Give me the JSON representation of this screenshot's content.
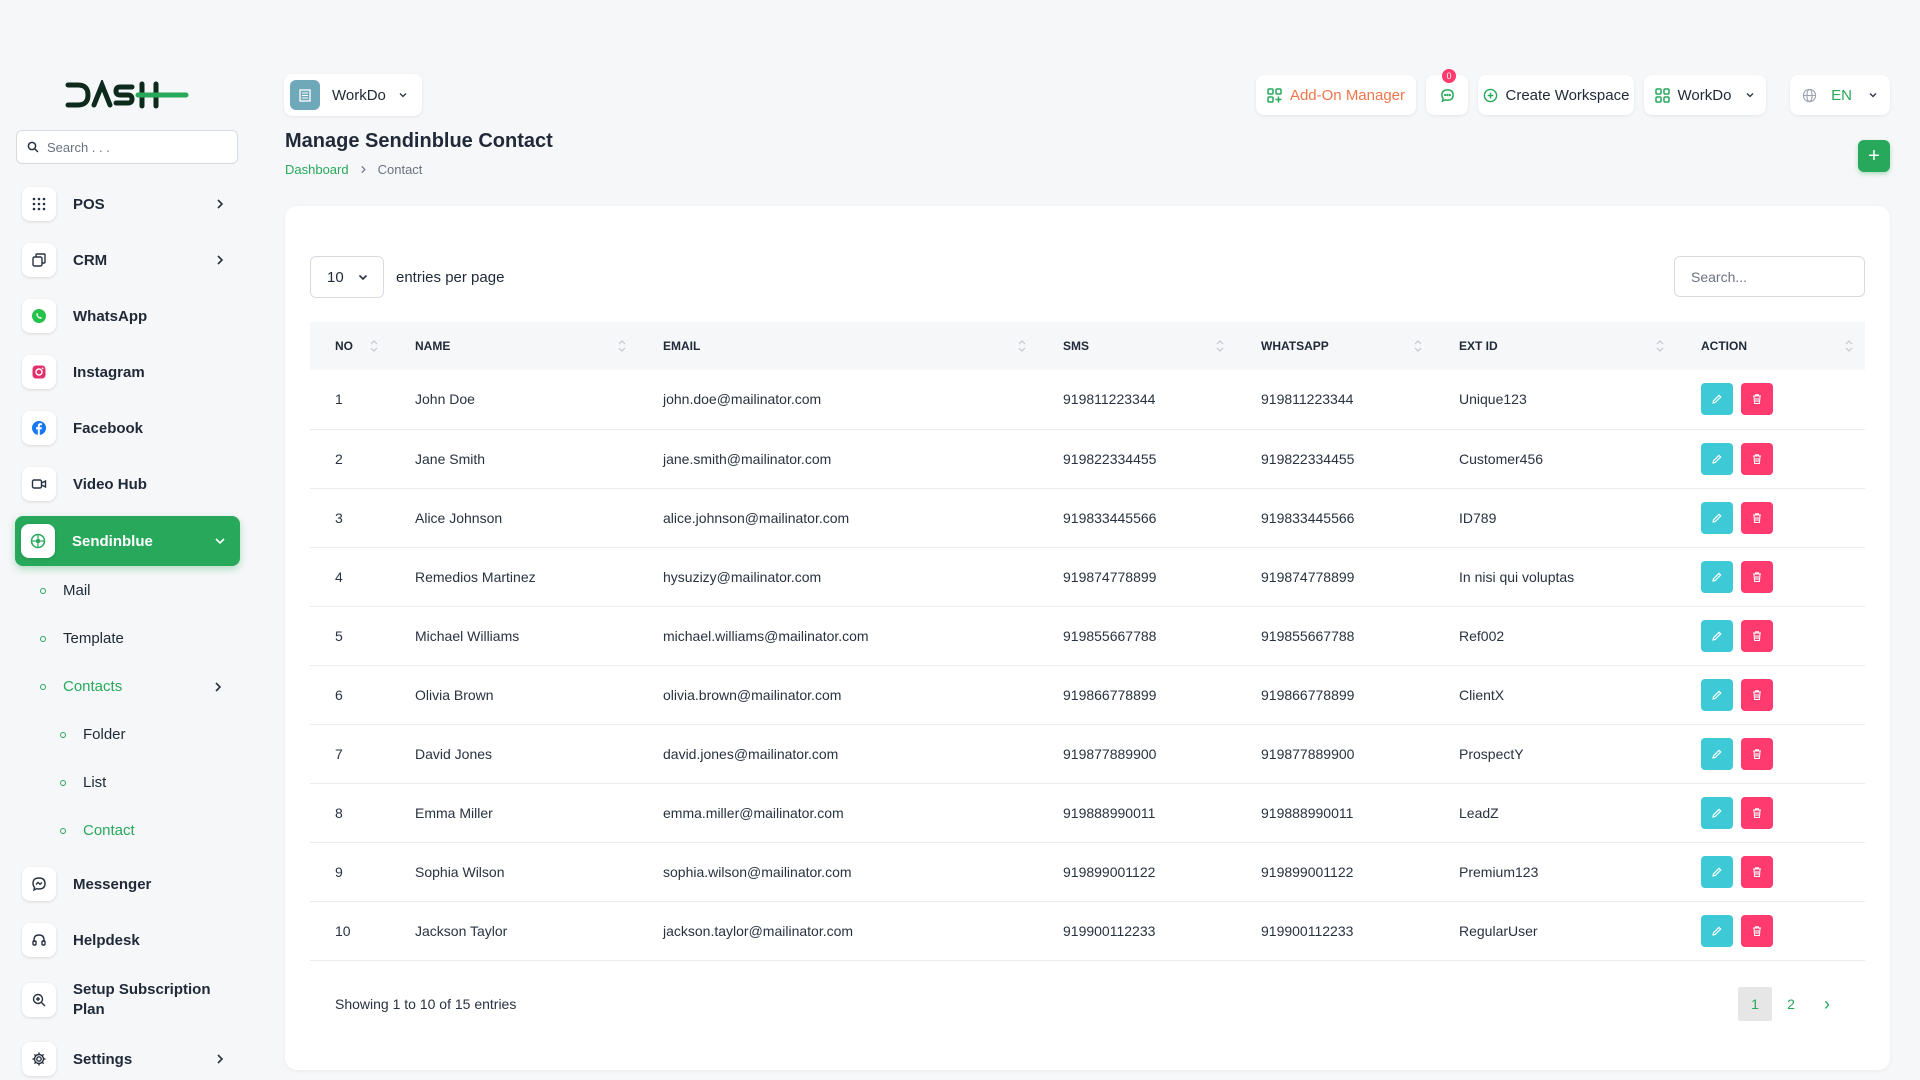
{
  "brand": {
    "logo_text": "DASH",
    "accent": "#27a85a"
  },
  "sidebar": {
    "search_placeholder": "Search . . .",
    "items": [
      {
        "label": "POS",
        "icon": "grid-icon",
        "has_children": true
      },
      {
        "label": "CRM",
        "icon": "layers-icon",
        "has_children": true
      },
      {
        "label": "WhatsApp",
        "icon": "whatsapp-icon",
        "has_children": false
      },
      {
        "label": "Instagram",
        "icon": "instagram-icon",
        "has_children": false
      },
      {
        "label": "Facebook",
        "icon": "facebook-icon",
        "has_children": false
      },
      {
        "label": "Video Hub",
        "icon": "video-icon",
        "has_children": false
      },
      {
        "label": "Sendinblue",
        "icon": "sendinblue-icon",
        "has_children": true,
        "active": true
      }
    ],
    "sendinblue_sub": {
      "mail": "Mail",
      "template": "Template",
      "contacts": "Contacts",
      "contacts_sub": {
        "folder": "Folder",
        "list": "List",
        "contact": "Contact"
      }
    },
    "lower_items": [
      {
        "label": "Messenger",
        "icon": "messenger-icon"
      },
      {
        "label": "Helpdesk",
        "icon": "headset-icon"
      },
      {
        "label": "Setup Subscription Plan",
        "label_line1": "Setup Subscription",
        "label_line2": "Plan",
        "icon": "search-plan-icon"
      },
      {
        "label": "Settings",
        "icon": "gear-icon",
        "has_children": true
      }
    ]
  },
  "topbar": {
    "workspace_name": "WorkDo",
    "addon_manager": "Add-On Manager",
    "messages_badge": "0",
    "create_workspace": "Create Workspace",
    "workspace_menu": "WorkDo",
    "language": "EN"
  },
  "page": {
    "title": "Manage Sendinblue Contact",
    "breadcrumb": {
      "home": "Dashboard",
      "current": "Contact"
    },
    "add_label": "+"
  },
  "table_controls": {
    "entries_value": "10",
    "entries_label": "entries per page",
    "search_placeholder": "Search..."
  },
  "table": {
    "columns": [
      "NO",
      "NAME",
      "EMAIL",
      "SMS",
      "WHATSAPP",
      "EXT ID",
      "ACTION"
    ],
    "rows": [
      {
        "no": "1",
        "name": "John Doe",
        "email": "john.doe@mailinator.com",
        "sms": "919811223344",
        "whatsapp": "919811223344",
        "ext_id": "Unique123"
      },
      {
        "no": "2",
        "name": "Jane Smith",
        "email": "jane.smith@mailinator.com",
        "sms": "919822334455",
        "whatsapp": "919822334455",
        "ext_id": "Customer456"
      },
      {
        "no": "3",
        "name": "Alice Johnson",
        "email": "alice.johnson@mailinator.com",
        "sms": "919833445566",
        "whatsapp": "919833445566",
        "ext_id": "ID789"
      },
      {
        "no": "4",
        "name": "Remedios Martinez",
        "email": "hysuzizy@mailinator.com",
        "sms": "919874778899",
        "whatsapp": "919874778899",
        "ext_id": "In nisi qui voluptas"
      },
      {
        "no": "5",
        "name": "Michael Williams",
        "email": "michael.williams@mailinator.com",
        "sms": "919855667788",
        "whatsapp": "919855667788",
        "ext_id": "Ref002"
      },
      {
        "no": "6",
        "name": "Olivia Brown",
        "email": "olivia.brown@mailinator.com",
        "sms": "919866778899",
        "whatsapp": "919866778899",
        "ext_id": "ClientX"
      },
      {
        "no": "7",
        "name": "David Jones",
        "email": "david.jones@mailinator.com",
        "sms": "919877889900",
        "whatsapp": "919877889900",
        "ext_id": "ProspectY"
      },
      {
        "no": "8",
        "name": "Emma Miller",
        "email": "emma.miller@mailinator.com",
        "sms": "919888990011",
        "whatsapp": "919888990011",
        "ext_id": "LeadZ"
      },
      {
        "no": "9",
        "name": "Sophia Wilson",
        "email": "sophia.wilson@mailinator.com",
        "sms": "919899001122",
        "whatsapp": "919899001122",
        "ext_id": "Premium123"
      },
      {
        "no": "10",
        "name": "Jackson Taylor",
        "email": "jackson.taylor@mailinator.com",
        "sms": "919900112233",
        "whatsapp": "919900112233",
        "ext_id": "RegularUser"
      }
    ]
  },
  "footer": {
    "showing": "Showing 1 to 10 of 15 entries",
    "pages": [
      "1",
      "2"
    ],
    "current_page": "1",
    "next": "›"
  },
  "colors": {
    "edit": "#3ec9d6",
    "delete": "#ff3a6e",
    "addon": "#f0754a"
  }
}
